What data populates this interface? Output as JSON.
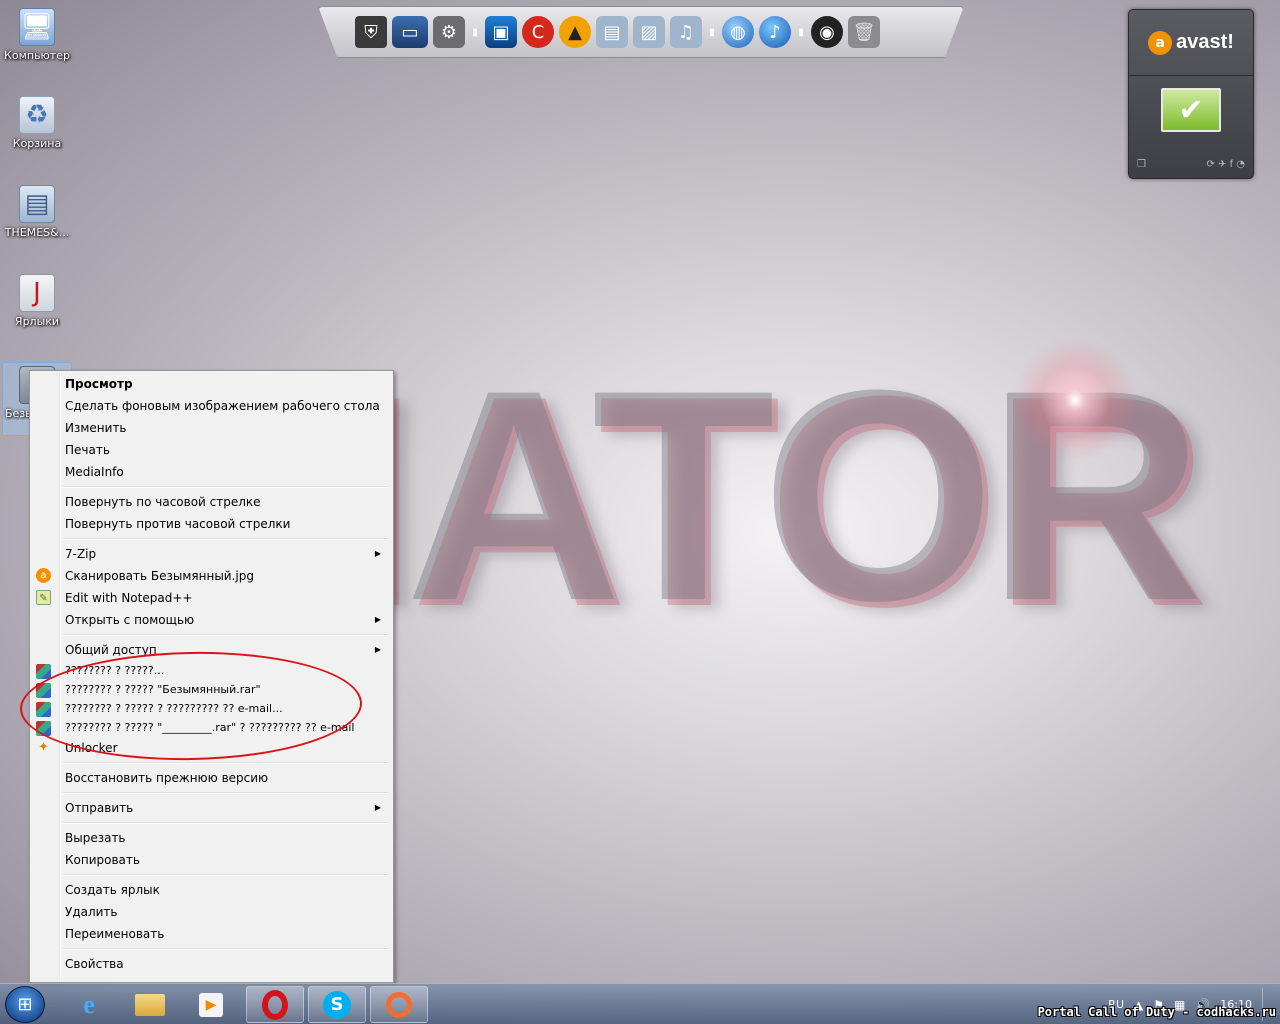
{
  "wallpaper": {
    "logo_text": "IATOR"
  },
  "desktop_icons": [
    {
      "label": "Компьютер",
      "icon": "computer-icon"
    },
    {
      "label": "Корзина",
      "icon": "recycle-bin-icon"
    },
    {
      "label": "THEMES&...",
      "icon": "folder-icon"
    },
    {
      "label": "Ярлыки",
      "icon": "folder-icon"
    },
    {
      "label": "Безы",
      "icon": "image-file-icon"
    }
  ],
  "dock": {
    "items": [
      "world-of-tanks-icon",
      "monitor-icon",
      "settings-icon",
      "display-icon",
      "ccleaner-icon",
      "aimp-icon",
      "documents-icon",
      "pictures-icon",
      "music-icon",
      "internet-icon",
      "itunes-icon",
      "speaker-icon",
      "trash-icon"
    ]
  },
  "avast": {
    "name": "avast!",
    "status": "protected",
    "accent": "#f39200"
  },
  "context_menu": {
    "groups": [
      [
        {
          "label": "Просмотр",
          "bold": true
        },
        {
          "label": "Сделать фоновым изображением рабочего стола"
        },
        {
          "label": "Изменить"
        },
        {
          "label": "Печать"
        },
        {
          "label": "MediaInfo"
        }
      ],
      [
        {
          "label": "Повернуть по часовой стрелке"
        },
        {
          "label": "Повернуть против часовой стрелки"
        }
      ],
      [
        {
          "label": "7-Zip",
          "submenu": true
        },
        {
          "label": "Сканировать Безымянный.jpg",
          "icon": "avast-icon"
        },
        {
          "label": "Edit with Notepad++",
          "icon": "notepad-plus-plus-icon"
        },
        {
          "label": "Открыть с помощью",
          "submenu": true
        }
      ],
      [
        {
          "label": "Общий доступ",
          "submenu": true
        },
        {
          "label": "???????? ? ?????...",
          "icon": "winrar-icon"
        },
        {
          "label": "???????? ? ????? \"Безымянный.rar\"",
          "icon": "winrar-icon"
        },
        {
          "label": "???????? ? ????? ? ????????? ?? e-mail...",
          "icon": "winrar-icon"
        },
        {
          "label": "???????? ? ????? \"_________.rar\" ? ????????? ?? e-mail",
          "icon": "winrar-icon"
        },
        {
          "label": "Unlocker",
          "icon": "unlocker-wand-icon"
        }
      ],
      [
        {
          "label": "Восстановить прежнюю версию"
        }
      ],
      [
        {
          "label": "Отправить",
          "submenu": true
        }
      ],
      [
        {
          "label": "Вырезать"
        },
        {
          "label": "Копировать"
        }
      ],
      [
        {
          "label": "Создать ярлык"
        },
        {
          "label": "Удалить"
        },
        {
          "label": "Переименовать"
        }
      ],
      [
        {
          "label": "Свойства"
        }
      ]
    ],
    "annotation_color": "#d8141a"
  },
  "taskbar": {
    "pinned": [
      "start-orb-icon",
      "internet-explorer-icon",
      "explorer-folder-icon",
      "media-player-icon",
      "opera-icon",
      "skype-icon",
      "origin-icon"
    ],
    "tray": {
      "language": "RU",
      "time": "16:10"
    }
  },
  "watermark": "Portal Call of Duty - codhacks.ru"
}
